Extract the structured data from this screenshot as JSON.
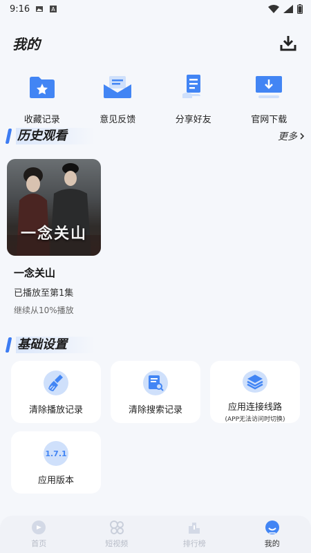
{
  "status": {
    "time": "9:16"
  },
  "header": {
    "title": "我的"
  },
  "quick_actions": [
    {
      "label": "收藏记录",
      "icon": "favorites-folder-icon"
    },
    {
      "label": "意见反馈",
      "icon": "feedback-mail-icon"
    },
    {
      "label": "分享好友",
      "icon": "share-document-icon"
    },
    {
      "label": "官网下载",
      "icon": "monitor-download-icon"
    }
  ],
  "history": {
    "section_title": "历史观看",
    "more_label": "更多",
    "items": [
      {
        "title": "一念关山",
        "poster_text": "一念关山",
        "episode": "已播放至第1集",
        "progress": "继续从10%播放"
      }
    ]
  },
  "settings": {
    "section_title": "基础设置",
    "items": [
      {
        "label": "清除播放记录",
        "icon": "broom-icon"
      },
      {
        "label": "清除搜索记录",
        "icon": "search-record-icon"
      },
      {
        "label": "应用连接线路",
        "sub": "(APP无法访问时切换)",
        "icon": "layers-icon"
      },
      {
        "label": "应用版本",
        "version": "1.7.1",
        "icon": "version-badge-icon"
      }
    ]
  },
  "tabs": [
    {
      "label": "首页",
      "icon": "home-icon",
      "active": false
    },
    {
      "label": "短视频",
      "icon": "short-video-icon",
      "active": false
    },
    {
      "label": "排行榜",
      "icon": "ranking-icon",
      "active": false
    },
    {
      "label": "我的",
      "icon": "profile-icon",
      "active": true
    }
  ],
  "colors": {
    "accent": "#3d7cf2",
    "icon_light": "#cfe0fb",
    "background": "#f5f7fb"
  }
}
